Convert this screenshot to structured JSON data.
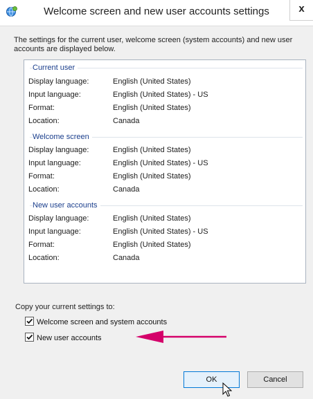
{
  "window": {
    "title": "Welcome screen and new user accounts settings",
    "close_label": "x",
    "icon": "globe-settings-icon"
  },
  "intro_text": "The settings for the current user, welcome screen (system accounts) and new user accounts are displayed below.",
  "groups": [
    {
      "title": "Current user",
      "rows": [
        {
          "label": "Display language:",
          "value": "English (United States)"
        },
        {
          "label": "Input language:",
          "value": "English (United States) - US"
        },
        {
          "label": "Format:",
          "value": "English (United States)"
        },
        {
          "label": "Location:",
          "value": "Canada"
        }
      ]
    },
    {
      "title": "Welcome screen",
      "rows": [
        {
          "label": "Display language:",
          "value": "English (United States)"
        },
        {
          "label": "Input language:",
          "value": "English (United States) - US"
        },
        {
          "label": "Format:",
          "value": "English (United States)"
        },
        {
          "label": "Location:",
          "value": "Canada"
        }
      ]
    },
    {
      "title": "New user accounts",
      "rows": [
        {
          "label": "Display language:",
          "value": "English (United States)"
        },
        {
          "label": "Input language:",
          "value": "English (United States) - US"
        },
        {
          "label": "Format:",
          "value": "English (United States)"
        },
        {
          "label": "Location:",
          "value": "Canada"
        }
      ]
    }
  ],
  "copy": {
    "label": "Copy your current settings to:",
    "options": [
      {
        "label": "Welcome screen and system accounts",
        "checked": true
      },
      {
        "label": "New user accounts",
        "checked": true
      }
    ]
  },
  "buttons": {
    "ok": "OK",
    "cancel": "Cancel"
  },
  "colors": {
    "group_title": "#1a3e8c",
    "annotation_arrow": "#d4006a",
    "ok_border": "#0078d7"
  }
}
